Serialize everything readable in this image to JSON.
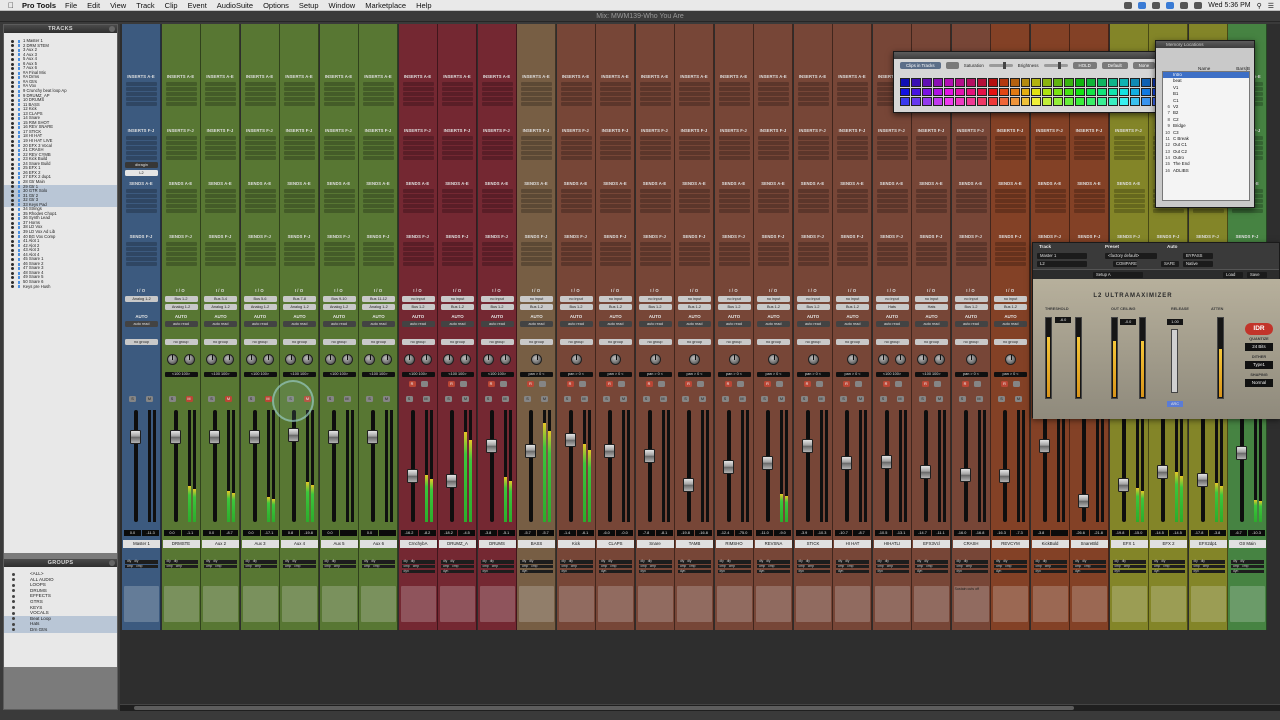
{
  "menubar": {
    "app": "Pro Tools",
    "menus": [
      "File",
      "Edit",
      "View",
      "Track",
      "Clip",
      "Event",
      "AudioSuite",
      "Options",
      "Setup",
      "Window",
      "Marketplace",
      "Help"
    ],
    "clock": "Wed 5:36 PM"
  },
  "window": {
    "title": "Mix: MWM139-Who You Are"
  },
  "tracks_panel": {
    "title": "TRACKS",
    "items": [
      "1 Master 1",
      "2 DRM STEM",
      "3 Aux 2",
      "4 Aux 3",
      "5 Aux 4",
      "6 Aux 5",
      "7 Aux 6",
      "#A Final Mix",
      "#A Drms",
      "#A Gtrs",
      "#A Vox",
      "9 Crunchy beat loop Ap",
      "9 DRUMZ_AP",
      "10 DRUMS",
      "11 BASS",
      "12 Kick",
      "13 CLAPS",
      "14 Snare",
      "15 RIM SHOT",
      "16 REV SNARE",
      "17 STICK",
      "18 HI HAT",
      "19 HI HAT LIVE",
      "20 EFX 3 Vocal",
      "21 CRASH",
      "22 REV CYMB",
      "23 Kick Build",
      "24 Snare Build",
      "25 EFX 1",
      "26 EFX 2",
      "27 EFX 2 dup1",
      "28 Gtr Main",
      "29 Gtr 1",
      "30 GTR Solo",
      "31 Gtr 2",
      "32 Gtr 3",
      "33 Keys Pad",
      "34 Strings",
      "35 Rhodes Chop1",
      "36 Synth Lead",
      "37 Horns",
      "38 LD Vox",
      "39 LD Vox Ad Lib",
      "40 BG Vox Comp",
      "41 Alot 1",
      "42 Alot 2",
      "43 Alot 3",
      "44 Alot 4",
      "45 Snare 1",
      "46 Snare 2",
      "47 Snare 3",
      "48 Snare 4",
      "49 Snare 5",
      "50 Snare 6",
      "Keys pre Hush"
    ],
    "selected": [
      32,
      33,
      34,
      35,
      36
    ]
  },
  "groups_panel": {
    "title": "GROUPS",
    "items": [
      "<ALL>",
      "ALL AUDIO",
      "LOOPS",
      "DRUMS",
      "EFFECTS",
      "GTRS",
      "KEYS",
      "VOCALS",
      "Beat Loop",
      "Hats",
      "Drn Gtrs"
    ],
    "selected": [
      8,
      9,
      10
    ]
  },
  "mixer": {
    "labels": {
      "inserts_ae": "INSERTS A-E",
      "inserts_fj": "INSERTS F-J",
      "sends_ae": "SENDS A-E",
      "sends_fj": "SENDS F-J",
      "io": "I / O",
      "auto": "AUTO",
      "auto_read": "auto read",
      "no_group": "no group",
      "dyn": "dyn",
      "dly": "dly",
      "cmp": "cmp",
      "rec": "R",
      "mute": "M",
      "solo": "S"
    },
    "strip1_inserts": [
      "dbragin",
      "L2"
    ],
    "strips": [
      {
        "name": "Master 1",
        "color": "#3f5f86",
        "input": "Analog 1-2",
        "output": "",
        "pan": "",
        "vol": "0.0",
        "peak": "-11.3",
        "meter": 0.0
      },
      {
        "name": "DRMSTE",
        "color": "#5d7d36",
        "input": "Bus 1-2",
        "output": "Analog 1-2",
        "pan": "<100  100>",
        "vol": "0.0",
        "peak": "-1.1",
        "meter": 0.32
      },
      {
        "name": "Aux 2",
        "color": "#5d7d36",
        "input": "Bus 3-4",
        "output": "Analog 1-2",
        "pan": "<100  100>",
        "vol": "0.0",
        "peak": "-8.7",
        "meter": 0.28
      },
      {
        "name": "Aux 3",
        "color": "#5d7d36",
        "input": "Bus 5-6",
        "output": "Analog 1-2",
        "pan": "<100  100>",
        "vol": "0.0",
        "peak": "-17.1",
        "meter": 0.22
      },
      {
        "name": "Aux 4",
        "color": "#5d7d36",
        "input": "Bus 7-8",
        "output": "Analog 1-2",
        "pan": "<100  100>",
        "vol": "0.8",
        "peak": "-19.8",
        "meter": 0.36
      },
      {
        "name": "Aux 5",
        "color": "#5d7d36",
        "input": "Bus 9-10",
        "output": "Analog 1-2",
        "pan": "<100  100>",
        "vol": "0.0",
        "peak": "",
        "meter": 0.0
      },
      {
        "name": "Aux 6",
        "color": "#5d7d36",
        "input": "Bus 11-12",
        "output": "Analog 1-2",
        "pan": "<100  100>",
        "vol": "0.0",
        "peak": "",
        "meter": 0.0
      },
      {
        "name": "CrnchybA",
        "color": "#7a2a35",
        "input": "no input",
        "output": "Bus 1-2",
        "pan": "<100  100>",
        "vol": "-16.2",
        "peak": "-8.2",
        "meter": 0.42
      },
      {
        "name": "DRUMZ_A",
        "color": "#7a2a35",
        "input": "no input",
        "output": "Bus 1-2",
        "pan": "<100  100>",
        "vol": "-18.2",
        "peak": "-4.5",
        "meter": 0.8
      },
      {
        "name": "DRUMS",
        "color": "#7a2a35",
        "input": "no input",
        "output": "Bus 1-2",
        "pan": "<100  100>",
        "vol": "-3.8",
        "peak": "-5.1",
        "meter": 0.4
      },
      {
        "name": "BASS",
        "color": "#7d6348",
        "input": "no input",
        "output": "Bus 1-2",
        "pan": "pan > 0 <",
        "vol": "-5.7",
        "peak": "-5.7",
        "meter": 0.88
      },
      {
        "name": "Kick",
        "color": "#7d4a3a",
        "input": "no input",
        "output": "Bus 1-2",
        "pan": "pan > 0 <",
        "vol": "-1.4",
        "peak": "-6.1",
        "meter": 0.7
      },
      {
        "name": "CLAPS",
        "color": "#7d4a3a",
        "input": "no input",
        "output": "Bus 1-2",
        "pan": "pan > 0 <",
        "vol": "-6.0",
        "peak": "-0.0",
        "meter": 0.0
      },
      {
        "name": "Snare",
        "color": "#7d4a3a",
        "input": "no input",
        "output": "Bus 1-2",
        "pan": "pan > 0 <",
        "vol": "-7.8",
        "peak": "-8.1",
        "meter": 0.0
      },
      {
        "name": "TAMB",
        "color": "#7d4a3a",
        "input": "no input",
        "output": "Bus 1-2",
        "pan": "pan > 0 <",
        "vol": "-19.8",
        "peak": "-16.8",
        "meter": 0.0
      },
      {
        "name": "RIMSHO",
        "color": "#7d4a3a",
        "input": "no input",
        "output": "Bus 1-2",
        "pan": "pan > 0 <",
        "vol": "-12.4",
        "peak": "-75.0",
        "meter": 0.0
      },
      {
        "name": "REVSNA",
        "color": "#7d4a3a",
        "input": "no input",
        "output": "Bus 1-2",
        "pan": "pan > 0 <",
        "vol": "-11.0",
        "peak": "-9.0",
        "meter": 0.25
      },
      {
        "name": "STICK",
        "color": "#7d4a3a",
        "input": "no input",
        "output": "Bus 1-2",
        "pan": "pan > 0 <",
        "vol": "-3.9",
        "peak": "-10.3",
        "meter": 0.0
      },
      {
        "name": "HI HAT",
        "color": "#7d4a3a",
        "input": "no input",
        "output": "Bus 1-2",
        "pan": "pan > 0 <",
        "vol": "-10.7",
        "peak": "-8.7",
        "meter": 0.0
      },
      {
        "name": "HIHATLI",
        "color": "#7d4a3a",
        "input": "no input",
        "output": "Hats",
        "pan": "<100  100>",
        "vol": "-10.5",
        "peak": "-13.1",
        "meter": 0.0
      },
      {
        "name": "EFX3Vcl",
        "color": "#7d4a3a",
        "input": "no input",
        "output": "Hats",
        "pan": "<100  100>",
        "vol": "-14.7",
        "peak": "-11.1",
        "meter": 0.0
      },
      {
        "name": "CRASH",
        "color": "#7d4a3a",
        "input": "no input",
        "output": "Bus 1-2",
        "pan": "pan > 0 <",
        "vol": "-16.0",
        "peak": "-16.8",
        "meter": 0.0
      },
      {
        "name": "REVCYM",
        "color": "#8a4428",
        "input": "no input",
        "output": "Bus 1-2",
        "pan": "pan > 0 <",
        "vol": "-16.3",
        "peak": "-7.3",
        "meter": 0.0
      },
      {
        "name": "KickBuld",
        "color": "#8a4428",
        "input": "no input",
        "output": "Bus 1-2",
        "pan": "pan > 0 <",
        "vol": "-3.8",
        "peak": "",
        "meter": 0.0
      },
      {
        "name": "SnareBld",
        "color": "#8a4428",
        "input": "no input",
        "output": "Bus 1-2",
        "pan": "pan > 0 <",
        "vol": "-26.6",
        "peak": "-21.8",
        "meter": 0.0
      },
      {
        "name": "EFX 1",
        "color": "#8a8c2a",
        "input": "no input",
        "output": "Bus 1-2",
        "pan": "<100  100>",
        "vol": "-19.8",
        "peak": "-15.0",
        "meter": 0.3
      },
      {
        "name": "EFX 2",
        "color": "#8a8c2a",
        "input": "no input",
        "output": "Bus 1-2",
        "pan": "<100  100>",
        "vol": "-14.5",
        "peak": "-14.5",
        "meter": 0.45
      },
      {
        "name": "EFX2dp1",
        "color": "#8a8c2a",
        "input": "no input",
        "output": "Bus 1-2",
        "pan": "<100  100>",
        "vol": "-17.8",
        "peak": "-3.8",
        "meter": 0.35
      },
      {
        "name": "Gtr Main",
        "color": "#4a8a46",
        "input": "no input",
        "output": "Bus 1-2",
        "pan": "<100  100>",
        "vol": "-6.7",
        "peak": "-10.3",
        "meter": 0.2
      }
    ],
    "comment_22": "Sustain cuts off"
  },
  "color_palette": {
    "title": "Clips in Tracks",
    "saturation_label": "Saturation",
    "brightness_label": "Brightness",
    "hold_label": "HOLD",
    "default_label": "Default",
    "none_label": "None"
  },
  "memory_locations": {
    "title": "Memory Locations",
    "col_name": "Name",
    "col_bars": "Bars|B",
    "items": [
      {
        "n": "",
        "name": "Intro"
      },
      {
        "n": "",
        "name": "beat"
      },
      {
        "n": "",
        "name": "V1"
      },
      {
        "n": "",
        "name": "B1"
      },
      {
        "n": "",
        "name": "C1"
      },
      {
        "n": "6",
        "name": "V2"
      },
      {
        "n": "7",
        "name": "B2"
      },
      {
        "n": "8",
        "name": "C2"
      },
      {
        "n": "9",
        "name": "Bridge"
      },
      {
        "n": "10",
        "name": "C3"
      },
      {
        "n": "11",
        "name": "C Break"
      },
      {
        "n": "12",
        "name": "Out C1"
      },
      {
        "n": "13",
        "name": "Out C2"
      },
      {
        "n": "14",
        "name": "Outro"
      },
      {
        "n": "15",
        "name": "The End"
      },
      {
        "n": "16",
        "name": "ADLIBS"
      }
    ]
  },
  "plugin": {
    "track_label": "Track",
    "preset_label": "Preset",
    "auto_label": "Auto",
    "track_value": "Master 1",
    "insert_value": "L2",
    "preset_value": "<factory default>",
    "compare_label": "COMPARE",
    "safe_label": "SAFE",
    "bypass_label": "BYPASS",
    "native_label": "Native",
    "setup_label": "Setup A",
    "load_label": "Load",
    "save_label": "Save",
    "title": "L2 ULTRAMAXIMIZER",
    "threshold_label": "THRESHOLD",
    "out_ceiling_label": "OUT CEILING",
    "release_label": "RELEASE",
    "atten_label": "ATTEN",
    "threshold_value": "-6.0",
    "ceiling_value": "-0.0",
    "release_value": "1.00",
    "arc_label": "ARC",
    "quantize_label": "QUANTIZE",
    "quantize_value": "24 Bits",
    "dither_label": "DITHER",
    "dither_value": "Type1",
    "shaping_label": "SHAPING",
    "shaping_value": "Normal",
    "brand": "IDR",
    "threshold_level": 0.75,
    "ceiling_level": 0.7,
    "atten_level": 0.6
  }
}
